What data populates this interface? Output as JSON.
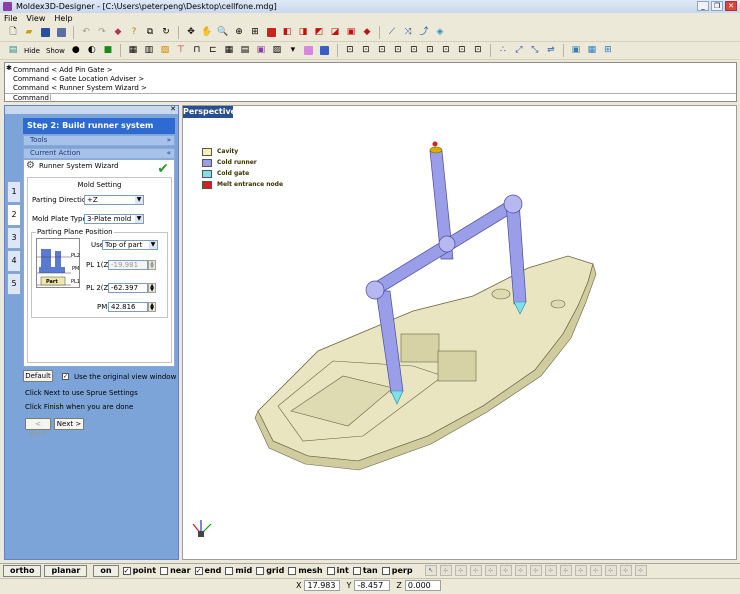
{
  "window": {
    "title": "Moldex3D-Designer - [C:\\Users\\peterpeng\\Desktop\\cellfone.mdg]",
    "minimize": "_",
    "restore": "❐",
    "close": "✕"
  },
  "menu": [
    "File",
    "View",
    "Help"
  ],
  "toolbar2": {
    "hide_label": "Hide",
    "show_label": "Show"
  },
  "command": {
    "history": [
      "Command < Add Pin Gate >",
      "Command < Gate Location Adviser >",
      "Command < Runner System Wizard >"
    ],
    "label": "Command",
    "value": ""
  },
  "panel": {
    "step_title": "Step 2: Build runner system",
    "tabs": [
      "1",
      "2",
      "3",
      "4",
      "5"
    ],
    "tools_label": "Tools",
    "current_action_label": "Current Action",
    "wizard_label": "Runner System Wizard",
    "mold_setting": "Mold Setting",
    "parting_direction_label": "Parting Direction :",
    "parting_direction_value": "+Z",
    "mold_plate_type_label": "Mold Plate Type :",
    "mold_plate_type_value": "3-Plate mold",
    "parting_plane_position": "Parting Plane Position",
    "use_label": "Use",
    "use_value": "Top of part",
    "pl1_label": "PL 1(Z)",
    "pl1_value": "-19.981",
    "pl2_label": "PL 2(Z)",
    "pl2_value": "-62.397",
    "pm_label": "PM",
    "pm_value": "42.816",
    "diagram_labels": {
      "pl2": "PL2",
      "pm": "PM",
      "pl1": "PL1",
      "part": "Part"
    },
    "default_button": "Default",
    "use_original_view": "Use the original view window",
    "note1": "Click Next to use Sprue Settings",
    "note2": "Click Finish when you are done",
    "back_button": "< Back",
    "next_button": "Next >"
  },
  "viewport": {
    "tab": "Perspective",
    "legend": [
      {
        "label": "Cavity",
        "color": "#f5f0b8"
      },
      {
        "label": "Cold runner",
        "color": "#9a9ee8"
      },
      {
        "label": "Cold gate",
        "color": "#7fe0e8"
      },
      {
        "label": "Melt entrance node",
        "color": "#d42020"
      }
    ]
  },
  "snap": {
    "ortho": "ortho",
    "planar": "planar",
    "on": "on",
    "items": [
      {
        "label": "point",
        "checked": true
      },
      {
        "label": "near",
        "checked": false
      },
      {
        "label": "end",
        "checked": true
      },
      {
        "label": "mid",
        "checked": false
      },
      {
        "label": "grid",
        "checked": false
      },
      {
        "label": "mesh",
        "checked": false
      },
      {
        "label": "int",
        "checked": false
      },
      {
        "label": "tan",
        "checked": false
      },
      {
        "label": "perp",
        "checked": false
      }
    ]
  },
  "status": {
    "x_label": "X",
    "x_value": "17.983",
    "y_label": "Y",
    "y_value": "-8.457",
    "z_label": "Z",
    "z_value": "0.000"
  }
}
